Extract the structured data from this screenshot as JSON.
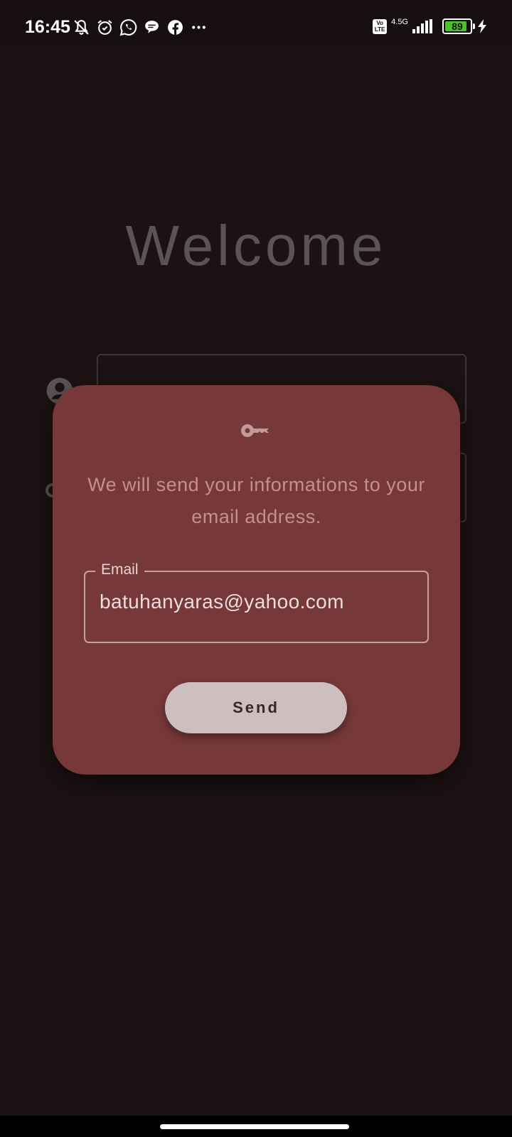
{
  "status_bar": {
    "time": "16:45",
    "icons": [
      "bell-off-icon",
      "alarm-icon",
      "whatsapp-icon",
      "chat-icon",
      "facebook-icon",
      "more-dots-icon"
    ],
    "volte_label": "Vo LTE",
    "network": "4.5G",
    "battery_percent": "89",
    "battery_level": 0.89,
    "charging": true
  },
  "background": {
    "title": "Welcome",
    "fields": [
      "username-field",
      "password-field"
    ]
  },
  "dialog": {
    "icon": "key-icon",
    "message": "We will send your informations to your email address.",
    "email_label": "Email",
    "email_value": "batuhanyaras@yahoo.com",
    "send_label": "Send"
  },
  "colors": {
    "background": "#1c1213",
    "dialog": "#763838",
    "button": "#cdbebf",
    "battery": "#4ec22b"
  }
}
